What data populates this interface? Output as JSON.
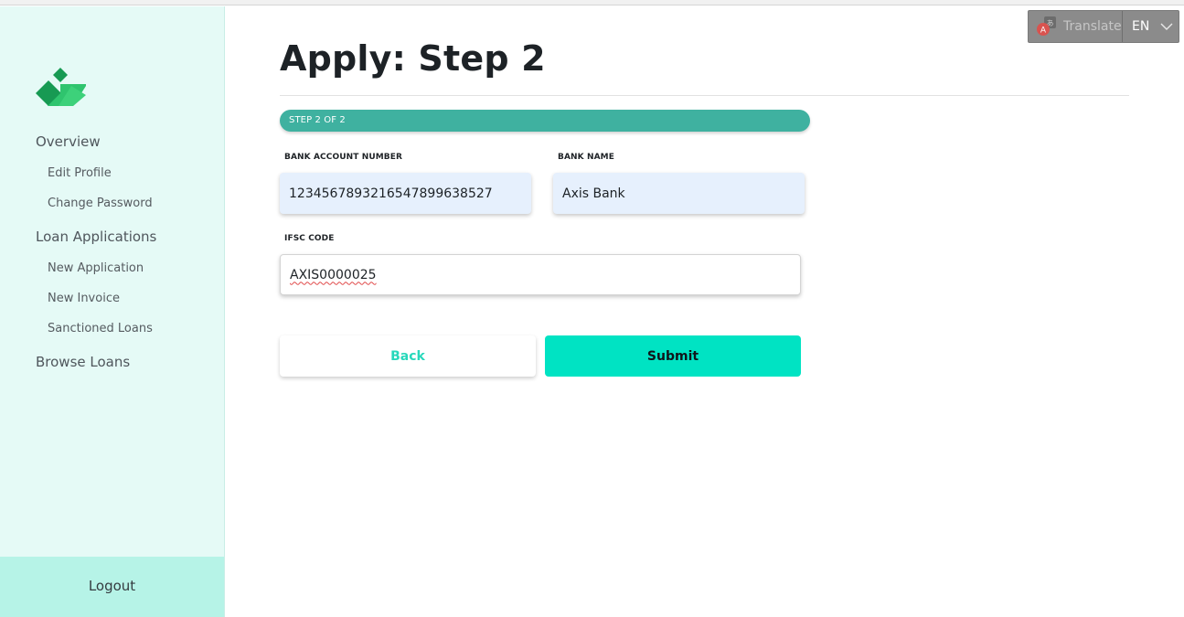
{
  "sidebar": {
    "items": [
      {
        "label": "Overview",
        "type": "main"
      },
      {
        "label": "Edit Profile",
        "type": "sub"
      },
      {
        "label": "Change Password",
        "type": "sub"
      },
      {
        "label": "Loan Applications",
        "type": "main"
      },
      {
        "label": "New Application",
        "type": "sub"
      },
      {
        "label": "New Invoice",
        "type": "sub"
      },
      {
        "label": "Sanctioned Loans",
        "type": "sub"
      },
      {
        "label": "Browse Loans",
        "type": "main"
      }
    ],
    "logout_label": "Logout"
  },
  "main": {
    "title": "Apply: Step 2",
    "progress_label": "STEP 2 OF 2",
    "progress_fraction": 1.0,
    "fields": {
      "bank_account": {
        "label": "BANK ACCOUNT NUMBER",
        "value": "1234567893216547899638527"
      },
      "bank_name": {
        "label": "BANK NAME",
        "value": "Axis Bank"
      },
      "ifsc": {
        "label": "IFSC CODE",
        "value": "AXIS0000025"
      }
    },
    "back_label": "Back",
    "submit_label": "Submit"
  },
  "translate": {
    "label": "Translate",
    "language": "EN",
    "icon": "google-translate-icon"
  },
  "colors": {
    "sidebar_bg": "#e5faf6",
    "logout_bg": "#b6f3e7",
    "progress": "#3fb1a0",
    "submit": "#00e3c3",
    "back_text": "#27d8bb",
    "field_filled": "#e6f0fd"
  }
}
